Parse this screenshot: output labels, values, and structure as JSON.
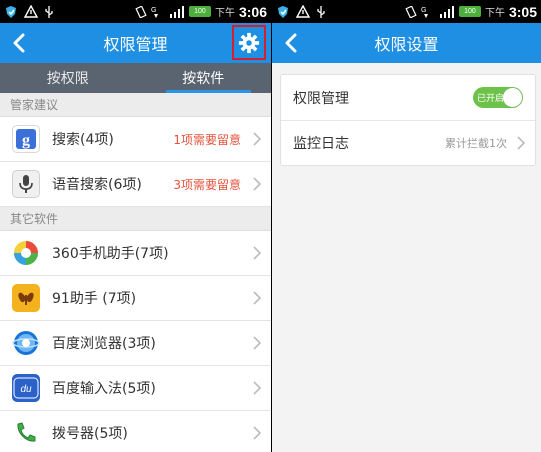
{
  "left": {
    "status": {
      "ampm": "下午",
      "time": "3:06",
      "battery": "100"
    },
    "title": "权限管理",
    "tabs": [
      {
        "label": "按权限"
      },
      {
        "label": "按软件"
      }
    ],
    "section1": "管家建议",
    "suggest": [
      {
        "label": "搜索(4项)",
        "warn": "1项需要留意",
        "icon": "google-search-icon"
      },
      {
        "label": "语音搜索(6项)",
        "warn": "3项需要留意",
        "icon": "voice-search-icon"
      }
    ],
    "section2": "其它软件",
    "apps": [
      {
        "label": "360手机助手(7项)",
        "icon": "360-assistant-icon"
      },
      {
        "label": "91助手 (7项)",
        "icon": "91-assistant-icon"
      },
      {
        "label": "百度浏览器(3项)",
        "icon": "baidu-browser-icon"
      },
      {
        "label": "百度输入法(5项)",
        "icon": "baidu-ime-icon"
      },
      {
        "label": "拨号器(5项)",
        "icon": "dialer-icon"
      }
    ],
    "baidu_ime_glyph": "du"
  },
  "right": {
    "status": {
      "ampm": "下午",
      "time": "3:05",
      "battery": "100"
    },
    "title": "权限设置",
    "perm_label": "权限管理",
    "toggle_label": "已开启",
    "log_label": "监控日志",
    "log_sub": "累计拦截1次"
  },
  "colors": {
    "header": "#1e8fe3",
    "warn": "#e6533c",
    "toggle": "#6cc24a",
    "highlight": "#d61f2c"
  }
}
